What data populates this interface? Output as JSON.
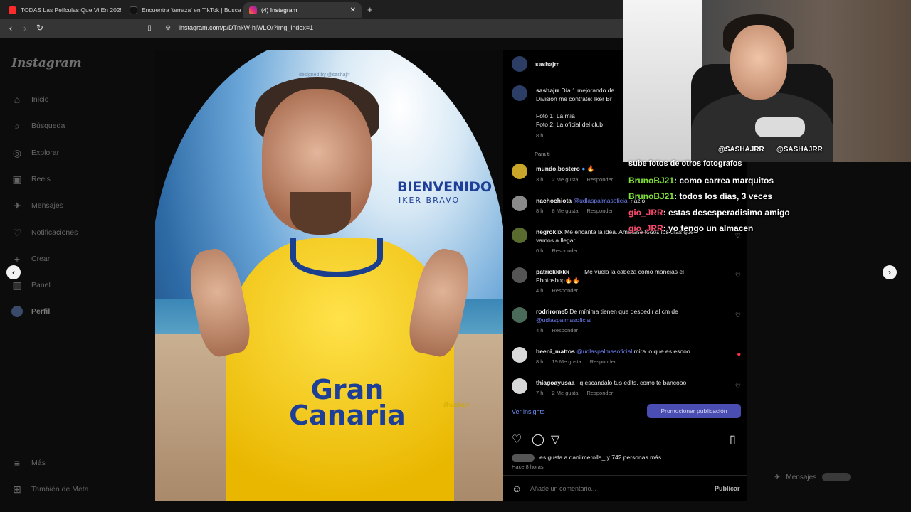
{
  "browser": {
    "tabs": [
      {
        "label": "TODAS Las Películas Que Vi En 2025",
        "favicon_color": "#ff2b2b"
      },
      {
        "label": "Encuentra 'terraza' en TikTok | Busca",
        "favicon_color": "#1b1b1b"
      },
      {
        "label": "(4) Instagram",
        "favicon_color": "#e1306c"
      }
    ],
    "url": "instagram.com/p/DTnkW-hjWLO/?img_index=1"
  },
  "sidebar": {
    "logo": "Instagram",
    "items": [
      {
        "label": "Inicio",
        "icon": "home-icon"
      },
      {
        "label": "Búsqueda",
        "icon": "search-icon"
      },
      {
        "label": "Explorar",
        "icon": "compass-icon"
      },
      {
        "label": "Reels",
        "icon": "reels-icon"
      },
      {
        "label": "Mensajes",
        "icon": "messenger-icon"
      },
      {
        "label": "Notificaciones",
        "icon": "heart-icon"
      },
      {
        "label": "Crear",
        "icon": "plus-icon"
      },
      {
        "label": "Panel",
        "icon": "chart-icon"
      },
      {
        "label": "Perfil",
        "icon": "profile-icon"
      }
    ],
    "more": "Más",
    "meta": "También de Meta"
  },
  "post": {
    "designed_by": "designed by @sashajrr",
    "headline": "BIENVENIDO",
    "subheadline": "IKER BRAVO",
    "sponsor_line1": "Gran",
    "sponsor_line2": "Canaria",
    "watermark": "@sashajrr"
  },
  "panel": {
    "author": "sashajrr",
    "caption_user": "sashajrr",
    "caption_text": "Día 1 mejorando de",
    "caption_line2": "División me contrate: Iker Br",
    "caption_line3": "Foto 1: La mía",
    "caption_line4": "Foto 2: La oficial del club",
    "caption_time": "8 h",
    "filter_label": "Para ti",
    "comments": [
      {
        "user": "mundo.bostero",
        "text": "🔥",
        "time": "3 h",
        "likes": "2 Me gusta",
        "reply": "Responder"
      },
      {
        "user": "nachochiota",
        "mention": "@udlaspalmasoficial",
        "text": "hazlo",
        "time": "8 h",
        "likes": "8 Me gusta",
        "reply": "Responder"
      },
      {
        "user": "negroklix",
        "text": "Me encanta la idea. Ameterle todos los días que",
        "text2": "vamos a llegar",
        "time": "6 h",
        "reply": "Responder"
      },
      {
        "user": "patrickkkkk____",
        "text": "Me vuela la cabeza como manejas el",
        "text2": "Photoshop🔥🔥",
        "time": "4 h",
        "reply": "Responder"
      },
      {
        "user": "rodrirome5",
        "text": "De mínima tienen que despedir al cm de",
        "mention2": "@udlaspalmasoficial",
        "time": "4 h",
        "reply": "Responder"
      },
      {
        "user": "beeni_mattos",
        "mention": "@udlaspalmasoficial",
        "text": "mira lo que es esooo",
        "time": "8 h",
        "likes": "19 Me gusta",
        "reply": "Responder"
      },
      {
        "user": "thiagoayusaa_",
        "text": "q escandalo tus edits, como te bancooo",
        "time": "7 h",
        "likes": "2 Me gusta",
        "reply": "Responder"
      }
    ],
    "insights": "Ver insights",
    "promote": "Promocionar publicación",
    "likes_text": "Les gusta a daniimerolla_ y 742 personas más",
    "posted": "Hace 8 horas",
    "comment_placeholder": "Añade un comentario...",
    "publish": "Publicar"
  },
  "stream": {
    "handle1": "@SASHAJRR",
    "handle2": "@SASHAJRR",
    "chat_top": "sube fotos de otros fotografos",
    "chat": [
      {
        "user": "BrunoBJ21",
        "text": ": como carrea marquitos",
        "color": "#7fe23c"
      },
      {
        "user": "BrunoBJ21",
        "text": ": todos los días, 3 veces",
        "color": "#7fe23c"
      },
      {
        "user": "gio_JRR",
        "text": ": estas desesperadisimo amigo",
        "color": "#ff4a6e"
      },
      {
        "user": "gio_JRR",
        "text": ": yo tengo un almacen",
        "color": "#ff4a6e"
      }
    ]
  },
  "bottom": {
    "messages": "Mensajes"
  }
}
